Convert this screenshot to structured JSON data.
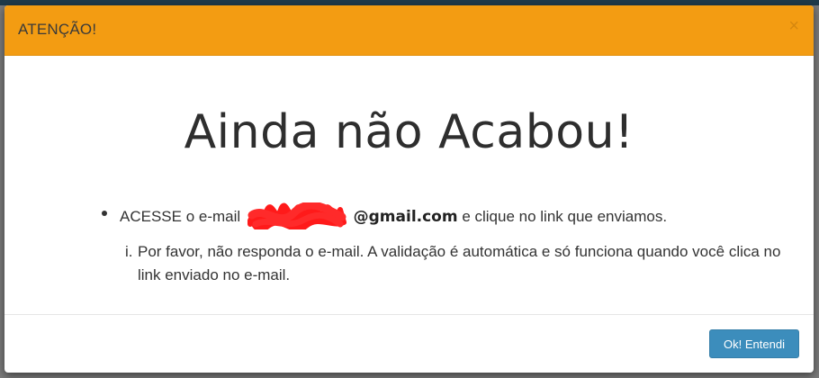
{
  "modal": {
    "title": "ATENÇÃO!",
    "close_glyph": "×",
    "headline": "Ainda não Acabou!",
    "instruction": {
      "prefix": "ACESSE o e-mail",
      "email_domain": "@gmail.com",
      "suffix": "e clique no link que enviamos.",
      "sub_marker": "i.",
      "sub_text": "Por favor, não responda o e-mail. A validação é automática e só funciona quando você clica no link enviado no e-mail."
    },
    "ok_button_label": "Ok! Entendi"
  },
  "colors": {
    "header_bg": "#f39c12",
    "button_bg": "#3c8dbc",
    "redaction": "#ff0000"
  }
}
